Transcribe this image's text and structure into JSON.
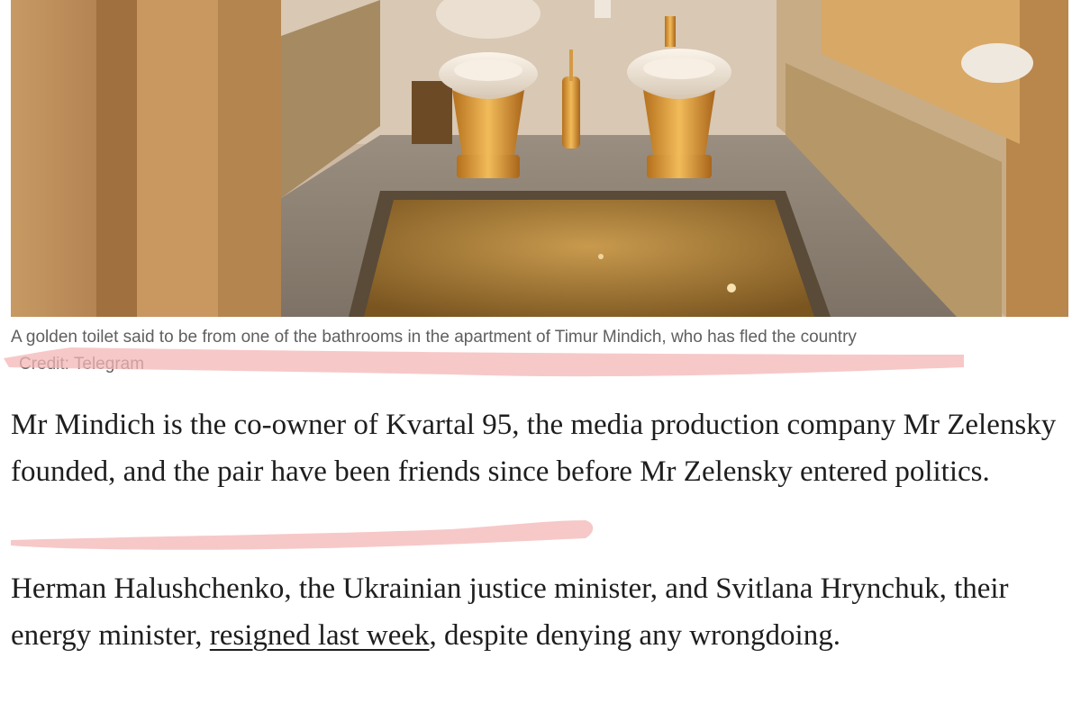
{
  "photo": {
    "subject": "golden toilet and bidet in marble bathroom"
  },
  "caption": {
    "text": "A golden toilet said to be from one of the bathrooms in the apartment of Timur Mindich, who has fled the country",
    "credit": "Credit: Telegram"
  },
  "article": {
    "paragraph1": "Mr Mindich is the co-owner of Kvartal 95, the media production company Mr Zelensky founded, and the pair have been friends since before Mr Zelensky entered politics.",
    "paragraph2_before": "Herman Halushchenko, the Ukrainian justice minister, and Svitlana Hrynchuk, their energy minister, ",
    "paragraph2_link": "resigned last week",
    "paragraph2_after": ", despite denying any wrongdoing."
  },
  "colors": {
    "highlight": "#f4b6b6",
    "text": "#1e1e1e",
    "caption": "#5f5f5f"
  }
}
